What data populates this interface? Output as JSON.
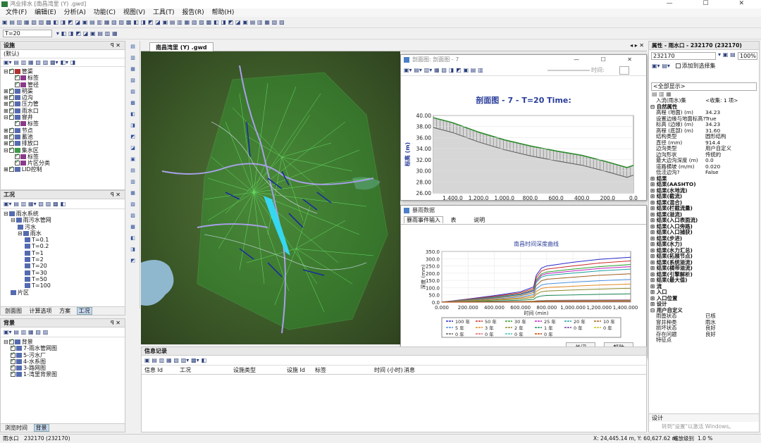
{
  "window": {
    "title": "鸿业排水 [南昌湾里 (Y) .gwd]"
  },
  "menu": [
    "文件(F)",
    "编辑(E)",
    "分析(A)",
    "功能(C)",
    "视图(V)",
    "工具(T)",
    "报告(R)",
    "帮助(H)"
  ],
  "toolbar": {
    "scenario": "T=20"
  },
  "left": {
    "facilities_title": "设施",
    "facilities_filter": "(默认)",
    "facilities_tree": [
      {
        "label": "管渠",
        "lvl": 0,
        "on": true,
        "exp": "⊟",
        "icon": "red"
      },
      {
        "label": "标签",
        "lvl": 2,
        "on": true,
        "icon": "pur"
      },
      {
        "label": "管径",
        "lvl": 2,
        "on": true,
        "icon": "pur"
      },
      {
        "label": "明渠",
        "lvl": 0,
        "on": true,
        "exp": "⊞",
        "icon": "blu"
      },
      {
        "label": "边沟",
        "lvl": 0,
        "on": true,
        "exp": "⊞",
        "icon": "blu"
      },
      {
        "label": "压力管",
        "lvl": 0,
        "on": true,
        "exp": "⊞",
        "icon": "blu"
      },
      {
        "label": "雨水口",
        "lvl": 0,
        "on": true,
        "exp": "⊞",
        "icon": "blu"
      },
      {
        "label": "窨井",
        "lvl": 0,
        "on": true,
        "exp": "⊟",
        "icon": "blu"
      },
      {
        "label": "标签",
        "lvl": 2,
        "on": true,
        "icon": "pur"
      },
      {
        "label": "节点",
        "lvl": 0,
        "on": true,
        "exp": "⊞",
        "icon": "blu"
      },
      {
        "label": "蓄池",
        "lvl": 0,
        "on": true,
        "exp": "⊞",
        "icon": "blu"
      },
      {
        "label": "排放口",
        "lvl": 0,
        "on": true,
        "exp": "⊞",
        "icon": "blu"
      },
      {
        "label": "集水区",
        "lvl": 0,
        "on": true,
        "exp": "⊟",
        "icon": "grn"
      },
      {
        "label": "标签",
        "lvl": 2,
        "on": true,
        "icon": "pur"
      },
      {
        "label": "片区分类",
        "lvl": 2,
        "on": true,
        "icon": "pur"
      },
      {
        "label": "LID控制",
        "lvl": 0,
        "on": true,
        "exp": "⊞",
        "icon": "blu"
      }
    ],
    "work_title": "工况",
    "work_tree": [
      {
        "label": "雨水系统",
        "lvl": 0,
        "exp": "⊟"
      },
      {
        "label": "雨污水管网",
        "lvl": 1,
        "exp": "⊟"
      },
      {
        "label": "污水",
        "lvl": 2
      },
      {
        "label": "雨水",
        "lvl": 2,
        "exp": "⊟"
      },
      {
        "label": "T=0.1",
        "lvl": 3
      },
      {
        "label": "T=0.2",
        "lvl": 3
      },
      {
        "label": "T=1",
        "lvl": 3
      },
      {
        "label": "T=2",
        "lvl": 3
      },
      {
        "label": "T=20",
        "lvl": 3
      },
      {
        "label": "T=30",
        "lvl": 3
      },
      {
        "label": "T=50",
        "lvl": 3
      },
      {
        "label": "T=100",
        "lvl": 3
      },
      {
        "label": "片区",
        "lvl": 1
      }
    ],
    "work_tabs": [
      "剖面图",
      "计算选项",
      "方案",
      "工况"
    ],
    "bg_title": "背景",
    "bg_tree": [
      {
        "label": "背景",
        "lvl": 0,
        "exp": "⊟"
      },
      {
        "label": "7-雨水管网图",
        "lvl": 1
      },
      {
        "label": "5-污水厂",
        "lvl": 1
      },
      {
        "label": "4-水系图",
        "lvl": 1
      },
      {
        "label": "3-路网图",
        "lvl": 1
      },
      {
        "label": "1-湾里背景图",
        "lvl": 1
      }
    ],
    "bg_tabs": [
      "浏览时间",
      "背景"
    ]
  },
  "map": {
    "tab": "南昌湾里 (Y) .gwd"
  },
  "profile": {
    "title": "剖面图: 剖面图 - 7",
    "chart_title": "剖面图 - 7 - T=20 Time:",
    "time_label": "时间:",
    "xlabel": "桩 (m)",
    "ylabel": "标高 (m)",
    "xticks": [
      "1,400.0",
      "1,200.0",
      "1,000.0",
      "800.0",
      "600.0",
      "400.0",
      "200.0",
      "0.0"
    ],
    "yticks": [
      "40.00",
      "38.00",
      "36.00",
      "34.00",
      "32.00",
      "30.00",
      "28.00",
      "26.00"
    ]
  },
  "rain": {
    "title": "暴雨数据",
    "tabs": [
      "暴雨事件输入",
      "表",
      "说明"
    ],
    "chart_title": "南昌时间深度曲线",
    "xlabel": "时间 (min)",
    "ylabel": "深度 (mm)",
    "xticks": [
      "0.000",
      "200.000",
      "400.000",
      "600.000",
      "800.000",
      "1,000.000",
      "1,200.000",
      "1,400.000"
    ],
    "yticks": [
      "350.0",
      "300.0",
      "250.0",
      "200.0",
      "150.0",
      "100.0",
      "50.0",
      "0.0"
    ],
    "close": "关闭",
    "help": "帮助"
  },
  "chart_data": [
    {
      "type": "line",
      "title": "剖面图 - 7 - T=20 Time:",
      "xlabel": "桩 (m)",
      "ylabel": "标高 (m)",
      "xlim": [
        1550,
        0
      ],
      "ylim": [
        26,
        40
      ],
      "series": [
        {
          "x": [
            1550,
            1400,
            1200,
            1000,
            800,
            600,
            400,
            200,
            50,
            0
          ],
          "values": [
            39.6,
            38.7,
            37.0,
            35.6,
            34.5,
            33.6,
            32.8,
            31.6,
            30.6,
            31.0
          ]
        }
      ]
    },
    {
      "type": "line",
      "title": "南昌时间深度曲线",
      "xlabel": "时间 (min)",
      "ylabel": "深度 (mm)",
      "xlim": [
        0,
        1440
      ],
      "ylim": [
        0,
        350
      ],
      "x": [
        0,
        200,
        400,
        600,
        700,
        720,
        760,
        800,
        1000,
        1200,
        1440
      ],
      "series": [
        {
          "name": "100 年",
          "color": "#2a2acc",
          "values": [
            0,
            22,
            45,
            72,
            105,
            185,
            235,
            250,
            275,
            295,
            310
          ]
        },
        {
          "name": "50 年",
          "color": "#cc2a2a",
          "values": [
            0,
            20,
            40,
            65,
            95,
            170,
            215,
            228,
            250,
            270,
            285
          ]
        },
        {
          "name": "30 年",
          "color": "#2aa02a",
          "values": [
            0,
            18,
            36,
            58,
            85,
            155,
            195,
            208,
            228,
            245,
            260
          ]
        },
        {
          "name": "25 年",
          "color": "#c020c0",
          "values": [
            0,
            17,
            34,
            55,
            80,
            145,
            185,
            197,
            215,
            232,
            245
          ]
        },
        {
          "name": "20 年",
          "color": "#20a0a0",
          "values": [
            0,
            16,
            32,
            52,
            75,
            135,
            173,
            184,
            201,
            216,
            228
          ]
        },
        {
          "name": "10 年",
          "color": "#a06020",
          "values": [
            0,
            14,
            28,
            45,
            65,
            115,
            148,
            158,
            172,
            185,
            196
          ]
        },
        {
          "name": "5 年",
          "color": "#4a90e0",
          "values": [
            0,
            11,
            22,
            36,
            52,
            92,
            118,
            126,
            138,
            148,
            157
          ]
        },
        {
          "name": "3 年",
          "color": "#e08a20",
          "values": [
            0,
            9,
            18,
            29,
            42,
            73,
            95,
            101,
            110,
            118,
            125
          ]
        },
        {
          "name": "2 年",
          "color": "#8a8a2a",
          "values": [
            0,
            7,
            14,
            22,
            32,
            55,
            72,
            77,
            84,
            90,
            96
          ]
        },
        {
          "name": "1 年",
          "color": "#208a5a",
          "values": [
            0,
            4,
            8,
            13,
            19,
            33,
            43,
            46,
            50,
            54,
            58
          ]
        },
        {
          "name": "0 年",
          "color": "#7a3aa0",
          "values": [
            0,
            2,
            3,
            5,
            7,
            9,
            11,
            12,
            13,
            14,
            15
          ]
        },
        {
          "name": "0 年",
          "color": "#c0c020",
          "values": [
            0,
            1,
            2,
            4,
            6,
            8,
            9,
            10,
            11,
            12,
            13
          ]
        },
        {
          "name": "0 年",
          "color": "#606060",
          "values": [
            0,
            1,
            2,
            3,
            4,
            6,
            7,
            8,
            9,
            10,
            11
          ]
        },
        {
          "name": "0 年",
          "color": "#e06060",
          "values": [
            0,
            1,
            1,
            2,
            3,
            4,
            5,
            6,
            7,
            8,
            9
          ]
        },
        {
          "name": "0 年",
          "color": "#40c0c0",
          "values": [
            0,
            1,
            1,
            2,
            2,
            3,
            4,
            5,
            5,
            6,
            7
          ]
        },
        {
          "name": "0 年",
          "color": "#c04000",
          "values": [
            0,
            0,
            1,
            1,
            2,
            2,
            3,
            4,
            4,
            5,
            5
          ]
        }
      ]
    }
  ],
  "messages": {
    "title": "信息记录",
    "columns": [
      "信息 Id",
      "工况",
      "设施类型",
      "设施 Id",
      "标签",
      "时间 (小时)",
      "消息"
    ]
  },
  "props": {
    "title": "属性 - 雨水口 - 232170 (232170)",
    "select": "232170",
    "zoom": "100%",
    "add_fav": "添加到选择集",
    "show_all": "<全部显示>",
    "rows": [
      {
        "k": "入流(雨水)集",
        "v": "<收集: 1 项>"
      },
      {
        "sec": "⊟ 自然属性"
      },
      {
        "k": "高程 (地面) (m)",
        "v": "34.23"
      },
      {
        "k": "设置边缘与地面标高?",
        "v": "True"
      },
      {
        "k": "标高 (边缘) (m)",
        "v": "34.23"
      },
      {
        "k": "高程 (底部) (m)",
        "v": "31.60"
      },
      {
        "k": "结构类型",
        "v": "圆形结构"
      },
      {
        "k": "直径 (mm)",
        "v": "914.4"
      },
      {
        "k": "边沟类型",
        "v": "用户自定义"
      },
      {
        "k": "边沟形状",
        "v": "传统的"
      },
      {
        "k": "最大边沟深度 (m)",
        "v": "0.0"
      },
      {
        "k": "道路横坡 (m/m)",
        "v": "0.020"
      },
      {
        "k": "低洼边沟?",
        "v": "False"
      },
      {
        "sec": "⊞ 结果"
      },
      {
        "sec": "⊞ 结果(AASHTO)"
      },
      {
        "sec": "⊞ 结果(水地流)"
      },
      {
        "sec": "⊞ 结果(截流)"
      },
      {
        "sec": "⊞ 结果(混合)"
      },
      {
        "sec": "⊞ 结果(栏截流量)"
      },
      {
        "sec": "⊞ 结果(溢流)"
      },
      {
        "sec": "⊞ 结果(入口表面流)"
      },
      {
        "sec": "⊞ 结果(入口旁路)"
      },
      {
        "sec": "⊞ 结果(入口捕获)"
      },
      {
        "sec": "⊞ 结果(步进)"
      },
      {
        "sec": "⊞ 结果(水力)"
      },
      {
        "sec": "⊞ 结果(水力汇总)"
      },
      {
        "sec": "⊞ 结果(拓展节点)"
      },
      {
        "sec": "⊞ 结果(系统溢流)"
      },
      {
        "sec": "⊞ 结果(横带溢流)"
      },
      {
        "sec": "⊞ 结果(引擎解析)"
      },
      {
        "sec": "⊞ 结果(最大值)"
      },
      {
        "sec": "⊞ 流"
      },
      {
        "sec": "⊞ 入口"
      },
      {
        "sec": "⊞ 入口位置"
      },
      {
        "sec": "⊞ 设计"
      },
      {
        "sec": "⊟ 用户自定义"
      },
      {
        "k": "雨篦状态",
        "v": "已核"
      },
      {
        "k": "窨井种类",
        "v": "雨水"
      },
      {
        "k": "损坏状态",
        "v": "良好"
      },
      {
        "k": "存在问题",
        "v": "良好"
      },
      {
        "k": "特征点",
        "v": ""
      }
    ],
    "footer": "设计",
    "watermark": "转到\"设置\"以激活 Windows。"
  },
  "status": {
    "left": "雨水口",
    "id": "232170 (232170)",
    "coords": "X: 24,445.14 m, Y: 60,627.62 m",
    "zoom_label": "缩放级别",
    "zoom": "1.0 %"
  }
}
